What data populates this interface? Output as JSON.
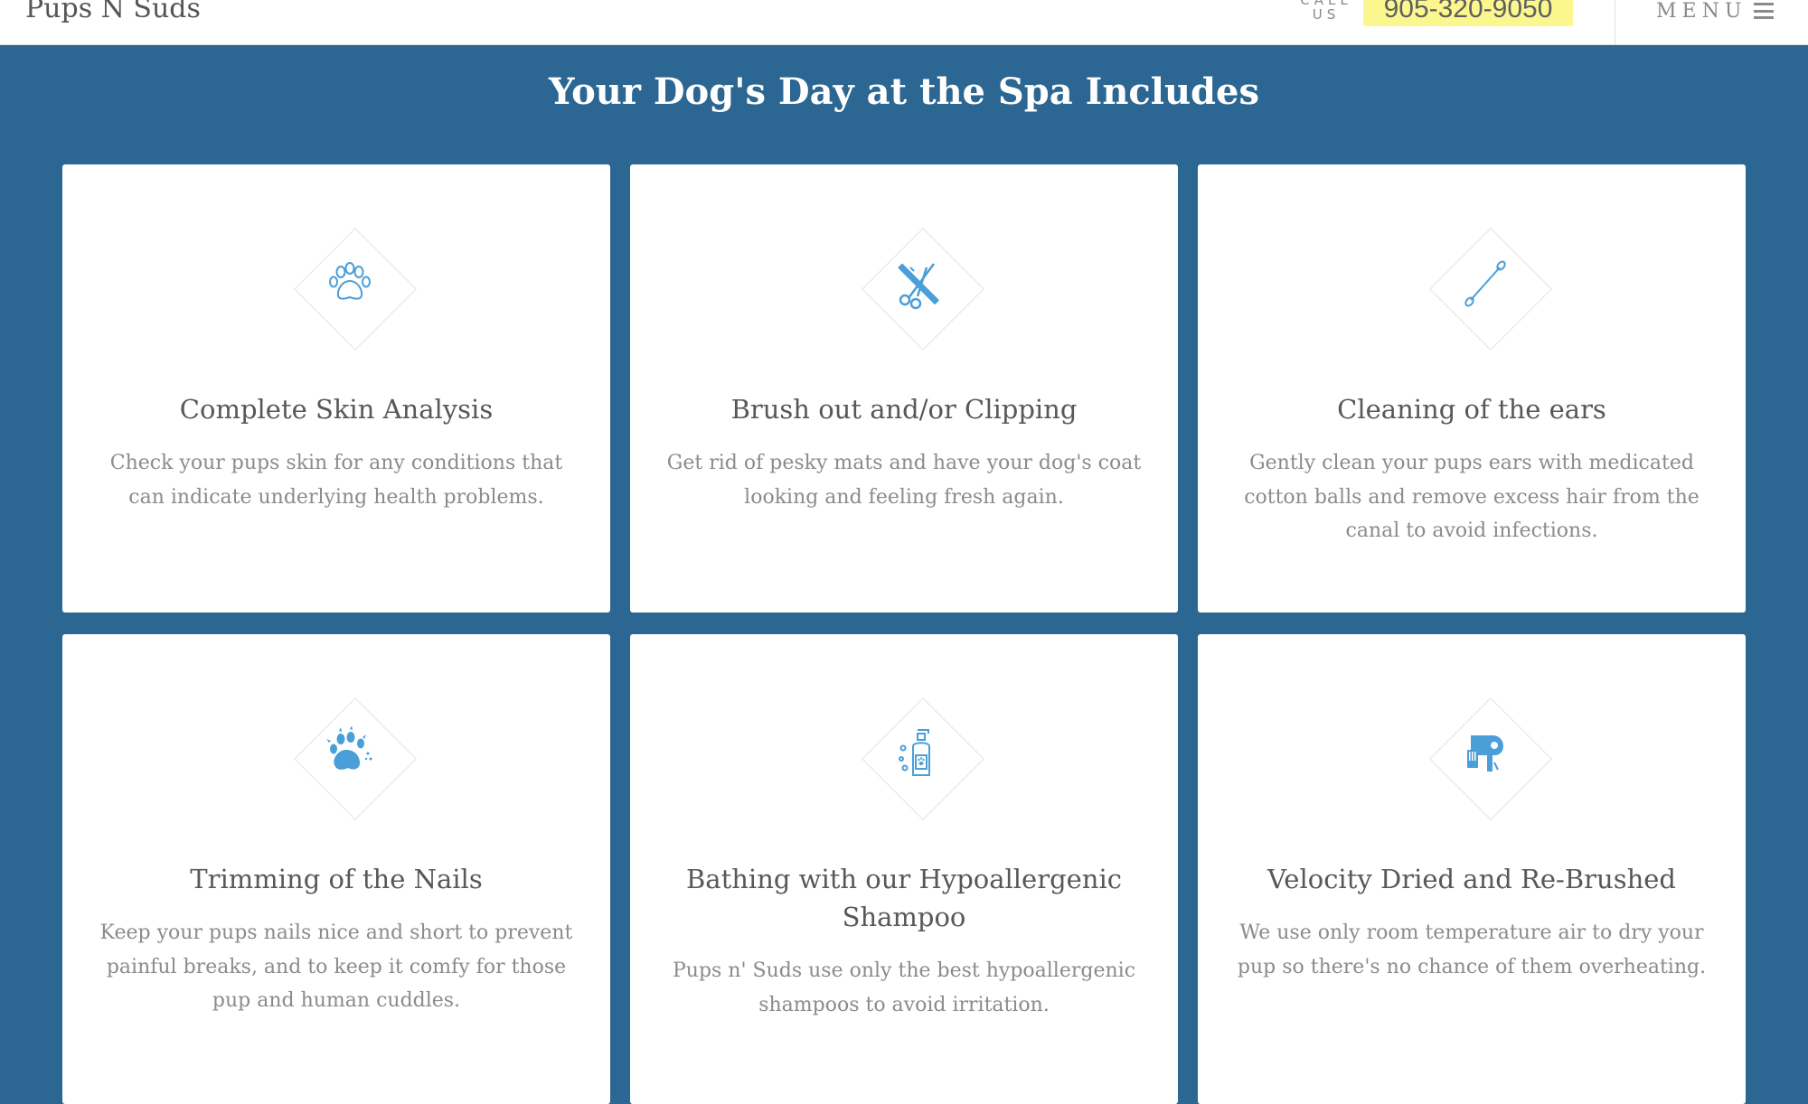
{
  "header": {
    "brand": "Pups N Suds",
    "call_label": "CALL US",
    "phone": "905-320-9050",
    "menu_label": "MENU"
  },
  "section": {
    "title": "Your Dog's Day at the Spa Includes"
  },
  "services": [
    {
      "icon": "paw-outline-icon",
      "title": "Complete Skin Analysis",
      "description": "Check your pups skin for any conditions that can indicate underlying health problems."
    },
    {
      "icon": "comb-scissors-icon",
      "title": "Brush out and/or Clipping",
      "description": "Get rid of pesky mats and have your dog's coat looking and feeling fresh again."
    },
    {
      "icon": "cotton-swab-icon",
      "title": "Cleaning of the ears",
      "description": "Gently clean your pups ears with medicated cotton balls and remove excess hair from the canal to avoid infections."
    },
    {
      "icon": "paw-claws-icon",
      "title": "Trimming of the Nails",
      "description": "Keep your pups nails nice and short to prevent painful breaks, and to keep it comfy for those pup and human cuddles."
    },
    {
      "icon": "shampoo-bottle-icon",
      "title": "Bathing with our Hypoallergenic Shampoo",
      "description": "Pups n' Suds use only the best hypoallergenic shampoos to avoid irritation."
    },
    {
      "icon": "hair-dryer-icon",
      "title": "Velocity Dried and Re-Brushed",
      "description": "We use only room temperature air to dry your pup so there's no chance of them overheating."
    }
  ],
  "colors": {
    "background": "#2c6692",
    "icon_accent": "#4a9fd8",
    "phone_highlight": "#fbf68e"
  }
}
